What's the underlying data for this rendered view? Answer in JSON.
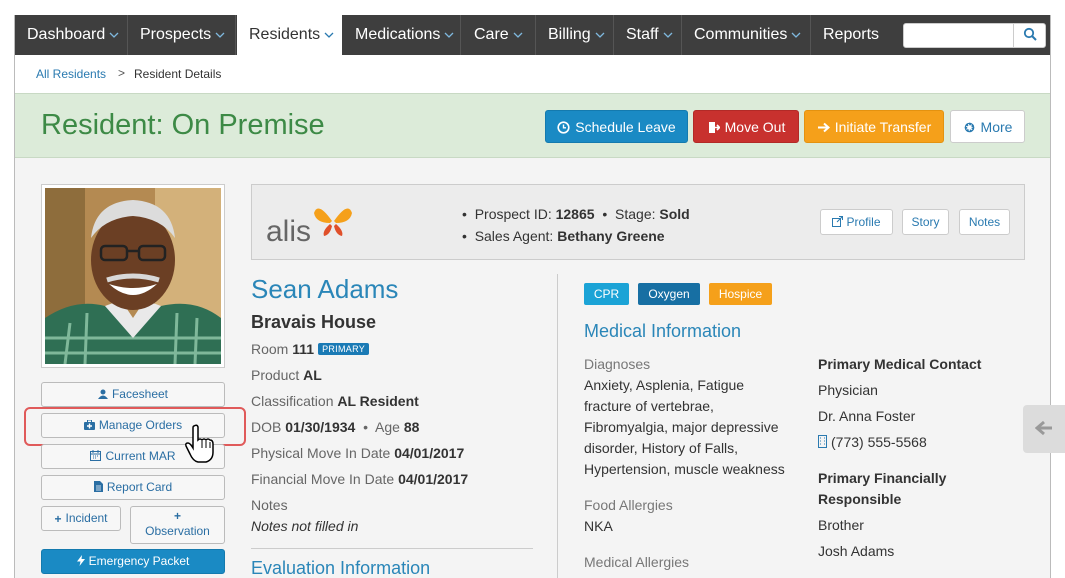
{
  "nav": {
    "items": [
      {
        "label": "Dashboard",
        "dropdown": true
      },
      {
        "label": "Prospects",
        "dropdown": true
      },
      {
        "label": "Residents",
        "dropdown": true,
        "active": true
      },
      {
        "label": "Medications",
        "dropdown": true
      },
      {
        "label": "Care",
        "dropdown": true
      },
      {
        "label": "Billing",
        "dropdown": true
      },
      {
        "label": "Staff",
        "dropdown": true
      },
      {
        "label": "Communities",
        "dropdown": true
      },
      {
        "label": "Reports",
        "dropdown": false
      }
    ],
    "search_value": "",
    "search_icon": "search-icon"
  },
  "breadcrumb": {
    "root": "All Residents",
    "separator": ">",
    "current": "Resident Details"
  },
  "header": {
    "title": "Resident: On Premise",
    "buttons": {
      "schedule_leave": "Schedule Leave",
      "move_out": "Move Out",
      "initiate_transfer": "Initiate Transfer",
      "more": "More"
    }
  },
  "sidebar": {
    "facesheet": "Facesheet",
    "manage_orders": "Manage Orders",
    "current_mar": "Current MAR",
    "report_card": "Report Card",
    "incident": "Incident",
    "observation_plus": "+",
    "observation": "Observation",
    "emergency_packet": "Emergency Packet"
  },
  "prospect": {
    "logo_text": "alis",
    "id_label": "Prospect ID:",
    "id_value": "12865",
    "stage_label": "Stage:",
    "stage_value": "Sold",
    "agent_label": "Sales Agent:",
    "agent_value": "Bethany Greene",
    "buttons": {
      "profile": "Profile",
      "story": "Story",
      "notes": "Notes"
    }
  },
  "resident": {
    "name": "Sean Adams",
    "community": "Bravais House",
    "room_label": "Room",
    "room_value": "111",
    "room_badge": "PRIMARY",
    "product_label": "Product",
    "product_value": "AL",
    "class_label": "Classification",
    "class_value": "AL Resident",
    "dob_label": "DOB",
    "dob_value": "01/30/1934",
    "age_label": "Age",
    "age_value": "88",
    "physical_label": "Physical Move In Date",
    "physical_value": "04/01/2017",
    "financial_label": "Financial Move In Date",
    "financial_value": "04/01/2017",
    "notes_label": "Notes",
    "notes_value": "Notes not filled in"
  },
  "evaluation_heading": "Evaluation Information",
  "tags": [
    {
      "label": "CPR",
      "color": "#1ba3d6"
    },
    {
      "label": "Oxygen",
      "color": "#176fa3"
    },
    {
      "label": "Hospice",
      "color": "#f5a01a"
    }
  ],
  "medical": {
    "heading": "Medical Information",
    "diagnoses_label": "Diagnoses",
    "diagnoses_lines": [
      "Anxiety, Asplenia, Fatigue",
      "fracture of vertebrae,",
      "Fibromyalgia, major depressive",
      "disorder, History of Falls,",
      "Hypertension, muscle weakness"
    ],
    "food_label": "Food Allergies",
    "food_value": "NKA",
    "med_allergies_label": "Medical Allergies"
  },
  "contacts": {
    "primary_medical_label": "Primary Medical Contact",
    "primary_medical_type": "Physician",
    "primary_medical_name": "Dr. Anna Foster",
    "primary_medical_phone": "(773) 555-5568",
    "financial_label_line1": "Primary Financially",
    "financial_label_line2": "Responsible",
    "financial_relation": "Brother",
    "financial_name": "Josh Adams"
  }
}
